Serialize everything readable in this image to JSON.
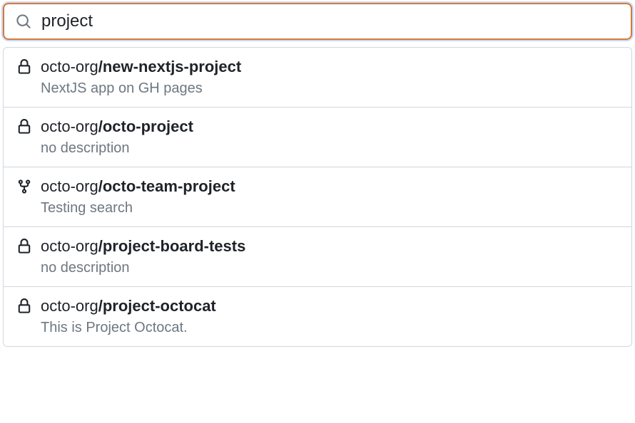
{
  "search": {
    "value": "project",
    "placeholder": ""
  },
  "results": [
    {
      "icon": "lock",
      "org": "octo-org",
      "repo": "new-nextjs-project",
      "description": "NextJS app on GH pages"
    },
    {
      "icon": "lock",
      "org": "octo-org",
      "repo": "octo-project",
      "description": "no description"
    },
    {
      "icon": "fork",
      "org": "octo-org",
      "repo": "octo-team-project",
      "description": "Testing search"
    },
    {
      "icon": "lock",
      "org": "octo-org",
      "repo": "project-board-tests",
      "description": "no description"
    },
    {
      "icon": "lock",
      "org": "octo-org",
      "repo": "project-octocat",
      "description": "This is Project Octocat."
    }
  ]
}
